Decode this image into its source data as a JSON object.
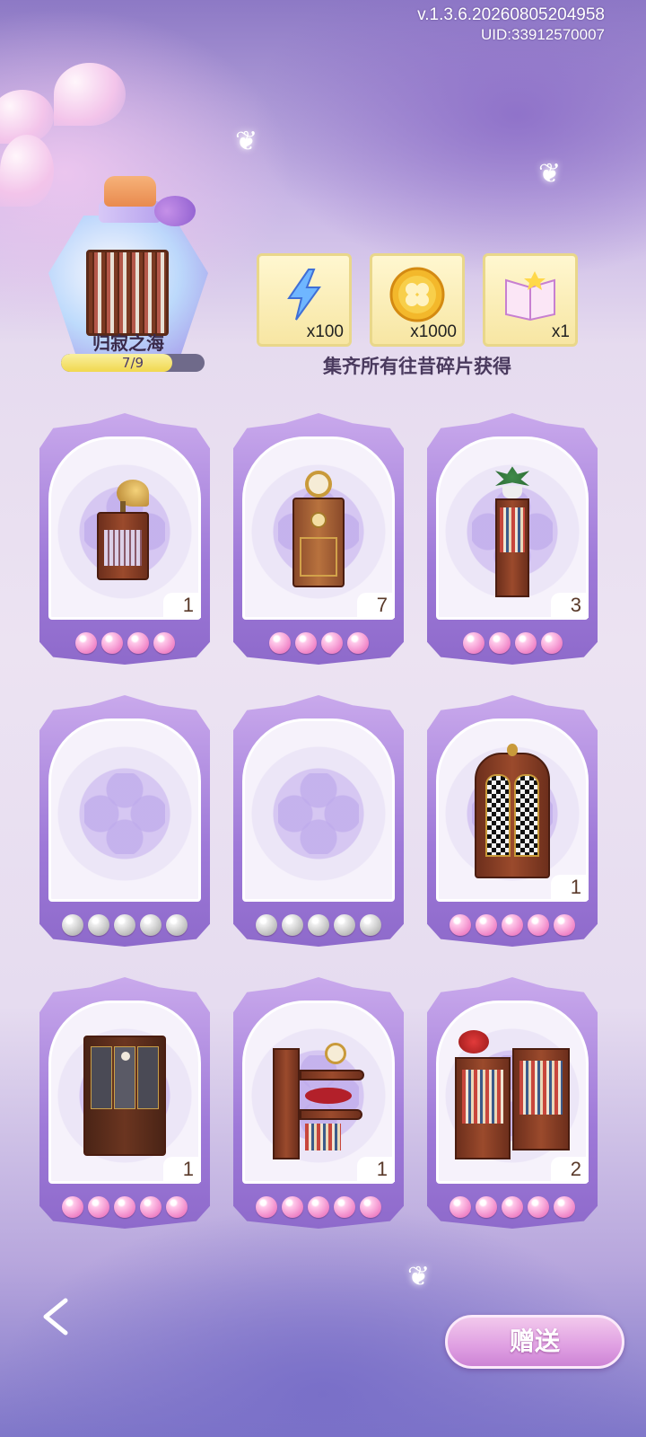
{
  "header": {
    "version": "v.1.3.6.20260805204958",
    "uid": "UID:33912570007"
  },
  "collection": {
    "name": "归寂之海",
    "progress_text": "7/9",
    "progress": 0.778
  },
  "rewards": {
    "items": [
      {
        "icon": "lightning-icon",
        "qty": "x100"
      },
      {
        "icon": "clover-coin-icon",
        "qty": "x1000"
      },
      {
        "icon": "book-icon",
        "qty": "x1"
      }
    ],
    "note": "集齐所有往昔碎片获得"
  },
  "cards": [
    {
      "item": "gramophone-cabinet",
      "count": "1",
      "owned": true,
      "stars": 4
    },
    {
      "item": "clock-cabinet",
      "count": "7",
      "owned": true,
      "stars": 4
    },
    {
      "item": "plant-bookshelf",
      "count": "3",
      "owned": true,
      "stars": 4
    },
    {
      "item": "",
      "count": "",
      "owned": false,
      "stars": 5
    },
    {
      "item": "",
      "count": "",
      "owned": false,
      "stars": 5
    },
    {
      "item": "ornate-wardrobe",
      "count": "1",
      "owned": true,
      "stars": 5
    },
    {
      "item": "glass-display-cabinet",
      "count": "1",
      "owned": true,
      "stars": 5
    },
    {
      "item": "curved-display-shelf",
      "count": "1",
      "owned": true,
      "stars": 5
    },
    {
      "item": "double-bookshelf",
      "count": "2",
      "owned": true,
      "stars": 5
    }
  ],
  "actions": {
    "gift_label": "赠送"
  },
  "colors": {
    "accent": "#9e79d8",
    "pearl_owned": "#f086c8",
    "pearl_empty": "#bdbdbd"
  }
}
